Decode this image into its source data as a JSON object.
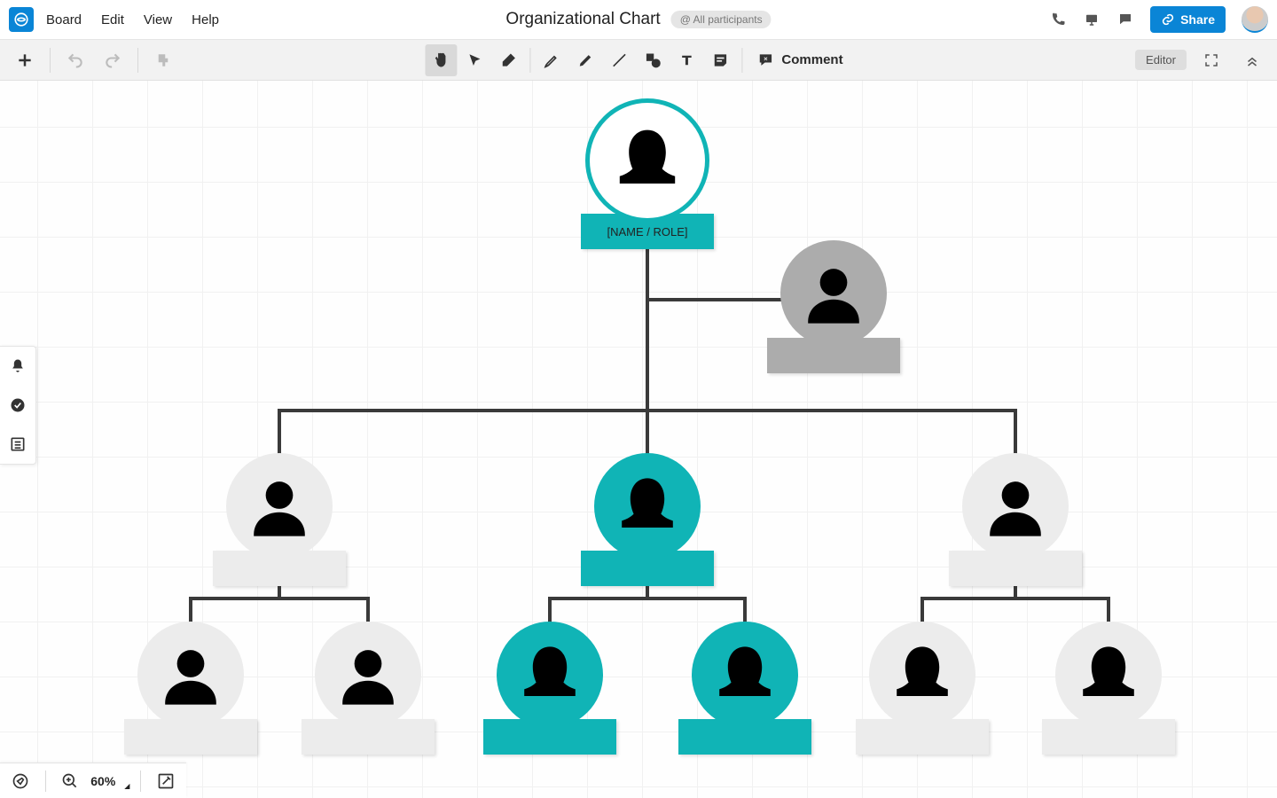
{
  "menubar": {
    "items": [
      "Board",
      "Edit",
      "View",
      "Help"
    ]
  },
  "header": {
    "title": "Organizational Chart",
    "participants": "@ All participants",
    "share": "Share"
  },
  "toolbar": {
    "comment": "Comment",
    "editor": "Editor"
  },
  "footer": {
    "zoom": "60%"
  },
  "org": {
    "root": {
      "label": "[NAME / ROLE]"
    }
  }
}
